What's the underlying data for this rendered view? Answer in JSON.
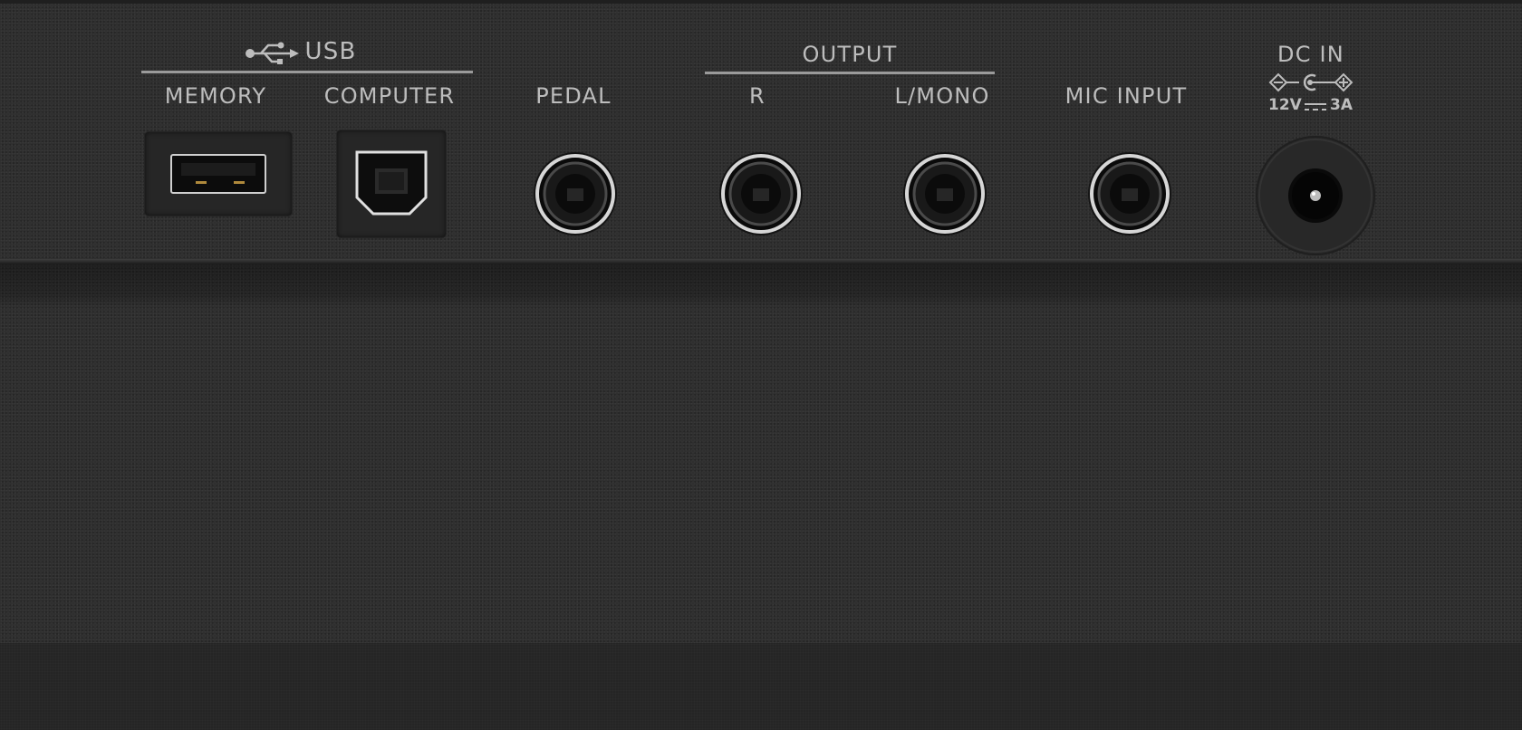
{
  "panel": {
    "usb": {
      "title": "USB",
      "icon": "usb-icon",
      "memory_label": "MEMORY",
      "computer_label": "COMPUTER"
    },
    "pedal": {
      "label": "PEDAL"
    },
    "output": {
      "title": "OUTPUT",
      "r_label": "R",
      "lmono_label": "L/MONO"
    },
    "mic": {
      "label": "MIC INPUT"
    },
    "dc_in": {
      "label": "DC IN",
      "polarity_icon": "center-positive-polarity-icon",
      "voltage": "12V",
      "current": "3A"
    }
  },
  "colors": {
    "panel": "#2d2d2d",
    "text": "#bdbdbd",
    "jack_ring": "#d6d6d6"
  }
}
